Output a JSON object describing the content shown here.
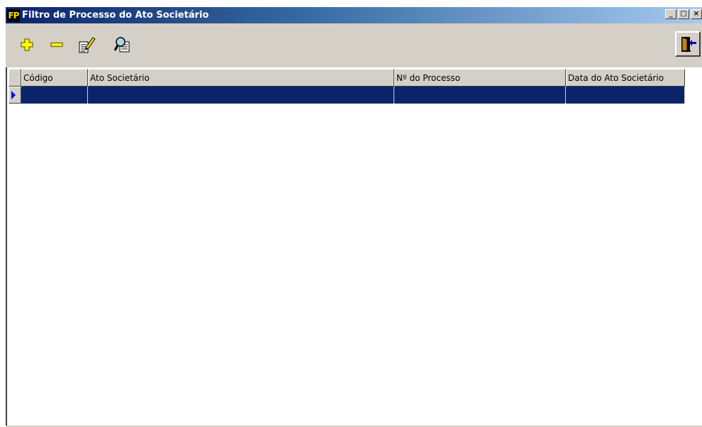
{
  "window": {
    "icon_text": "FP",
    "title": "Filtro de Processo do Ato Societário",
    "minimize": "_",
    "maximize": "□",
    "close": "×"
  },
  "toolbar": {
    "buttons": [
      {
        "name": "add",
        "icon": "plus-icon",
        "color": "#ffff00"
      },
      {
        "name": "remove",
        "icon": "minus-icon",
        "color": "#ffff00"
      },
      {
        "name": "edit",
        "icon": "edit-document-icon"
      },
      {
        "name": "search",
        "icon": "magnifier-icon"
      }
    ],
    "exit_icon": "exit-door-icon"
  },
  "grid": {
    "columns": [
      "Código",
      "Ato Societário",
      "Nº do Processo",
      "Data do Ato Societário"
    ],
    "rows": [
      [
        "",
        "",
        "",
        ""
      ]
    ],
    "selected_row_color": "#0a246a"
  }
}
